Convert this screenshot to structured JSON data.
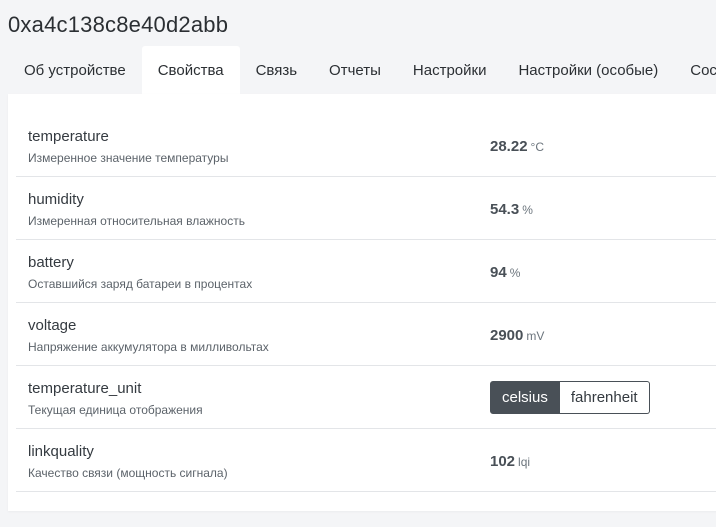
{
  "device": {
    "title": "0xa4c138c8e40d2abb"
  },
  "tabs": [
    {
      "label": "Об устройстве"
    },
    {
      "label": "Свойства",
      "active": true
    },
    {
      "label": "Связь"
    },
    {
      "label": "Отчеты"
    },
    {
      "label": "Настройки"
    },
    {
      "label": "Настройки (особые)"
    },
    {
      "label": "Состо"
    }
  ],
  "properties": [
    {
      "name": "temperature",
      "description": "Измеренное значение температуры",
      "value": "28.22",
      "unit": "°C"
    },
    {
      "name": "humidity",
      "description": "Измеренная относительная влажность",
      "value": "54.3",
      "unit": "%"
    },
    {
      "name": "battery",
      "description": "Оставшийся заряд батареи в процентах",
      "value": "94",
      "unit": "%"
    },
    {
      "name": "voltage",
      "description": "Напряжение аккумулятора в милливольтах",
      "value": "2900",
      "unit": "mV"
    },
    {
      "name": "temperature_unit",
      "description": "Текущая единица отображения",
      "options": [
        "celsius",
        "fahrenheit"
      ],
      "selected": "celsius"
    },
    {
      "name": "linkquality",
      "description": "Качество связи (мощность сигнала)",
      "value": "102",
      "unit": "lqi"
    }
  ]
}
